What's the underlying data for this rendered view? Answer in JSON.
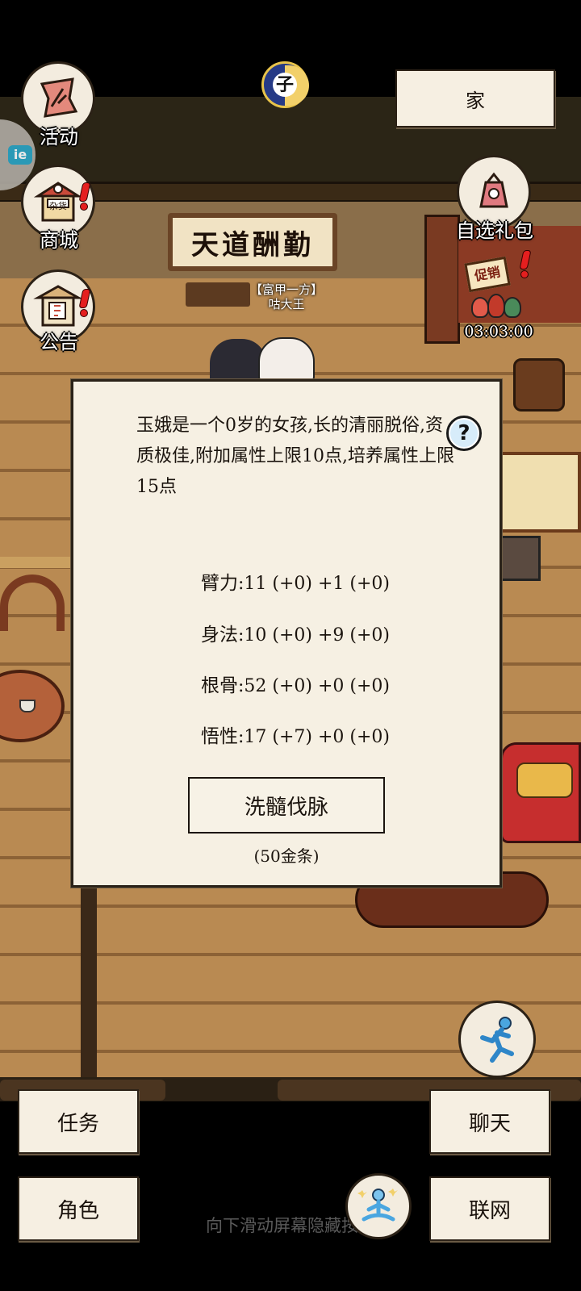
{
  "top": {
    "time_glyph": "子",
    "home_label": "家"
  },
  "left_menu": {
    "side_tab": "ie",
    "activity_label": "活动",
    "shop_label": "商城",
    "shop_sign": "杂货",
    "notice_label": "公告"
  },
  "right_menu": {
    "gift_label": "自选礼包",
    "promo_sign": "促销",
    "promo_timer": "03:03:00"
  },
  "scene": {
    "plaque_text": "天道酬勤",
    "npc_title": "【富甲一方】",
    "npc_name": "咕大王"
  },
  "modal": {
    "description": "玉娥是一个0岁的女孩,长的清丽脱俗,资质极佳,附加属性上限10点,培养属性上限15点",
    "help_label": "?",
    "stats": [
      {
        "name": "臂力",
        "value": ":11 (+0) +1 (+0)"
      },
      {
        "name": "身法",
        "value": ":10 (+0) +9 (+0)"
      },
      {
        "name": "根骨",
        "value": ":52 (+0) +0 (+0)"
      },
      {
        "name": "悟性",
        "value": ":17 (+7) +0 (+0)"
      }
    ],
    "button_label": "洗髓伐脉",
    "cost": "(50金条)"
  },
  "bottom": {
    "task_label": "任务",
    "chat_label": "聊天",
    "role_label": "角色",
    "net_label": "联网",
    "hint": "向下滑动屏幕隐藏按钮"
  },
  "colors": {
    "paper": "#f6f0e3",
    "alert_red": "#e51f1f",
    "wood": "#b98a52"
  }
}
